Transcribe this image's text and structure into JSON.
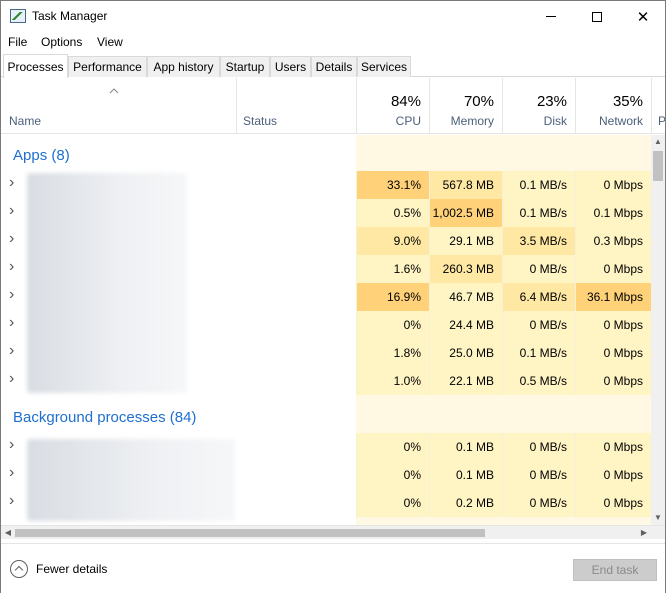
{
  "window": {
    "title": "Task Manager"
  },
  "menu": {
    "file": "File",
    "options": "Options",
    "view": "View"
  },
  "tabs": [
    "Processes",
    "Performance",
    "App history",
    "Startup",
    "Users",
    "Details",
    "Services"
  ],
  "header": {
    "name": "Name",
    "status": "Status",
    "cpu": {
      "pct": "84%",
      "label": "CPU"
    },
    "memory": {
      "pct": "70%",
      "label": "Memory"
    },
    "disk": {
      "pct": "23%",
      "label": "Disk"
    },
    "network": {
      "pct": "35%",
      "label": "Network"
    },
    "power_cut": "P"
  },
  "groups": {
    "apps": "Apps (8)",
    "background": "Background processes (84)"
  },
  "apps_rows": [
    {
      "cpu": "33.1%",
      "memory": "567.8 MB",
      "disk": "0.1 MB/s",
      "network": "0 Mbps"
    },
    {
      "cpu": "0.5%",
      "memory": "1,002.5 MB",
      "disk": "0.1 MB/s",
      "network": "0.1 Mbps"
    },
    {
      "cpu": "9.0%",
      "memory": "29.1 MB",
      "disk": "3.5 MB/s",
      "network": "0.3 Mbps"
    },
    {
      "cpu": "1.6%",
      "memory": "260.3 MB",
      "disk": "0 MB/s",
      "network": "0 Mbps"
    },
    {
      "cpu": "16.9%",
      "memory": "46.7 MB",
      "disk": "6.4 MB/s",
      "network": "36.1 Mbps"
    },
    {
      "cpu": "0%",
      "memory": "24.4 MB",
      "disk": "0 MB/s",
      "network": "0 Mbps"
    },
    {
      "cpu": "1.8%",
      "memory": "25.0 MB",
      "disk": "0.1 MB/s",
      "network": "0 Mbps"
    },
    {
      "cpu": "1.0%",
      "memory": "22.1 MB",
      "disk": "0.5 MB/s",
      "network": "0 Mbps"
    }
  ],
  "bg_rows": [
    {
      "cpu": "0%",
      "memory": "0.1 MB",
      "disk": "0 MB/s",
      "network": "0 Mbps"
    },
    {
      "cpu": "0%",
      "memory": "0.1 MB",
      "disk": "0 MB/s",
      "network": "0 Mbps"
    },
    {
      "cpu": "0%",
      "memory": "0.2 MB",
      "disk": "0 MB/s",
      "network": "0 Mbps"
    }
  ],
  "footer": {
    "fewer_details": "Fewer details",
    "end_task": "End task"
  },
  "colors": {
    "heat_light": "#fff4c4",
    "heat_mid": "#ffe8a3",
    "heat_hot": "#ffd27a",
    "heat_header": "#fff9e4",
    "group_blue": "#1e6fd0"
  }
}
